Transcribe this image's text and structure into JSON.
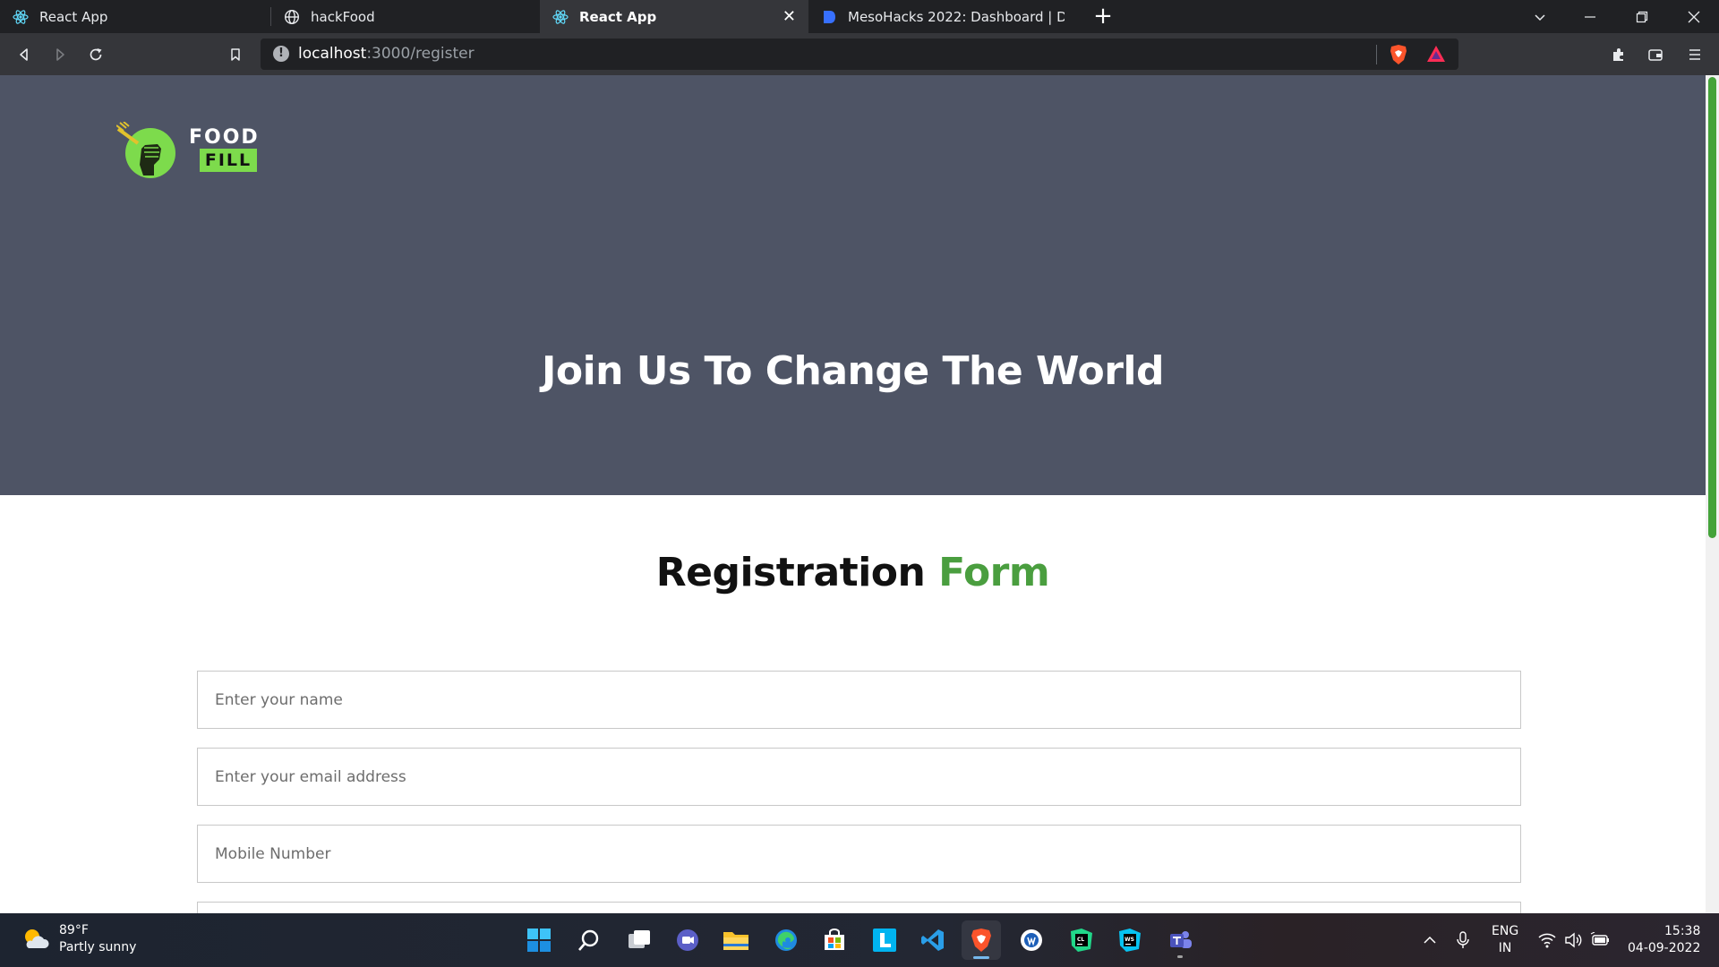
{
  "browser": {
    "tabs": [
      {
        "title": "React App",
        "icon": "react-icon",
        "active": false
      },
      {
        "title": "hackFood",
        "icon": "globe-icon",
        "active": false
      },
      {
        "title": "React App",
        "icon": "react-icon",
        "active": true
      },
      {
        "title": "MesoHacks 2022: Dashboard | Devfolio",
        "icon": "devfolio-icon",
        "active": false
      }
    ],
    "new_tab": "+",
    "url_host": "localhost",
    "url_rest": ":3000/register"
  },
  "page": {
    "logo_word_1": "FOOD",
    "logo_word_2": "FILL",
    "hero_title": "Join Us To Change The World",
    "form_title_main": "Registration",
    "form_title_accent": "Form",
    "fields": {
      "name_placeholder": "Enter your name",
      "email_placeholder": "Enter your email address",
      "mobile_placeholder": "Mobile Number"
    },
    "colors": {
      "hero_bg": "#4e5465",
      "accent_green": "#4a9e3f",
      "logo_green": "#7ddb4c"
    }
  },
  "taskbar": {
    "weather_temp": "89°F",
    "weather_desc": "Partly sunny",
    "apps": [
      "windows-start-icon",
      "search-icon",
      "task-view-icon",
      "teams-chat-icon",
      "file-explorer-icon",
      "edge-icon",
      "store-icon",
      "l-app-icon",
      "vscode-icon",
      "brave-icon",
      "app-icon",
      "clion-icon",
      "webstorm-icon",
      "teams-icon"
    ],
    "lang_1": "ENG",
    "lang_2": "IN",
    "time": "15:38",
    "date": "04-09-2022"
  }
}
